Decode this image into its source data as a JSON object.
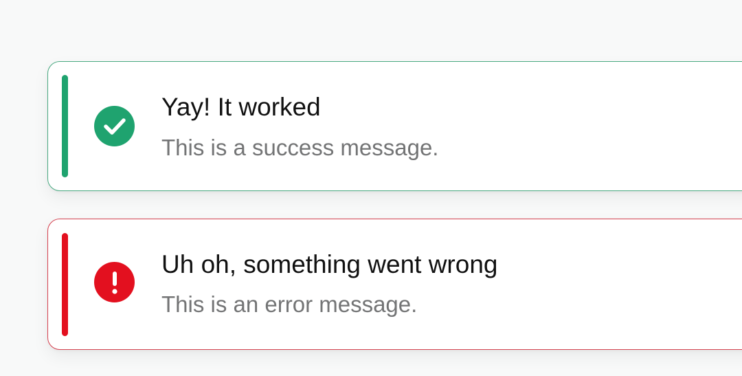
{
  "toasts": {
    "success": {
      "title": "Yay! It worked",
      "message": "This is a success message.",
      "icon": "check-circle-icon",
      "color": "#1fa36f",
      "border_color": "#49a981"
    },
    "error": {
      "title": "Uh oh, something went wrong",
      "message": "This is an error message.",
      "icon": "exclamation-circle-icon",
      "color": "#e3101f",
      "border_color": "#d5414f"
    }
  }
}
